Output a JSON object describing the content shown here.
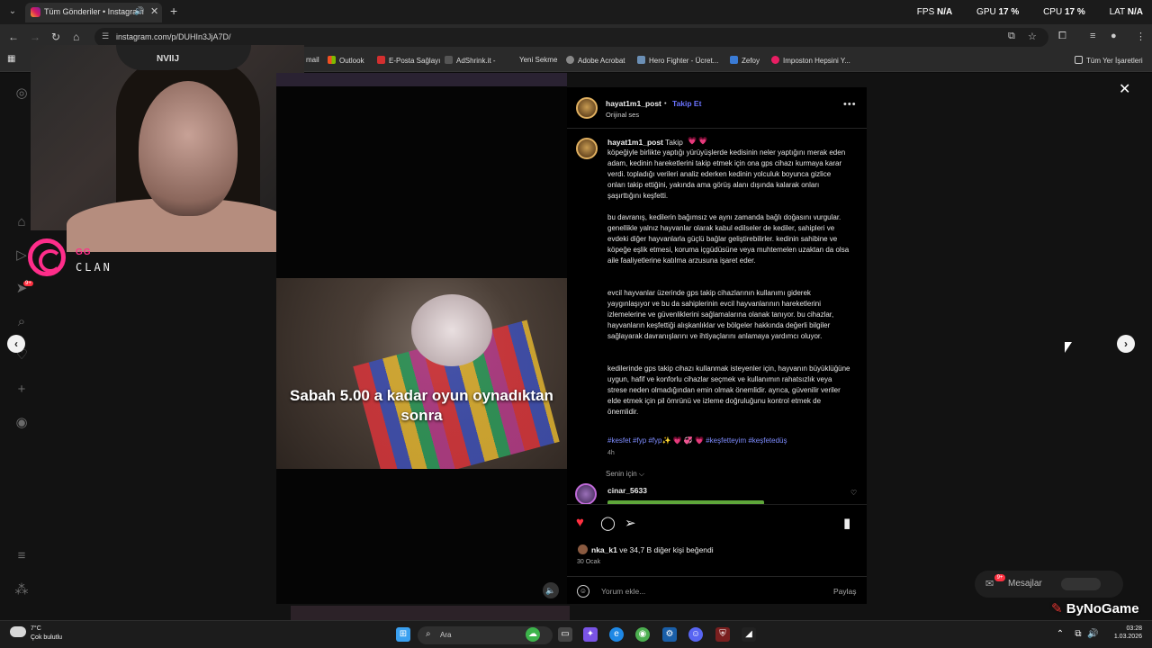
{
  "browser": {
    "tab_title": "Tüm Gönderiler • Instagram",
    "url": "instagram.com/p/DUHIn3JjA7D/",
    "stats": [
      {
        "label": "FPS",
        "value": "N/A"
      },
      {
        "label": "GPU",
        "value": "17 %"
      },
      {
        "label": "CPU",
        "value": "17 %"
      },
      {
        "label": "LAT",
        "value": "N/A"
      }
    ],
    "bookmarks": [
      "mail",
      "Outlook",
      "E-Posta Sağlayı",
      "AdShrink.it -",
      "Yeni Sekme",
      "Adobe Acrobat",
      "Hero Fighter - Ücret...",
      "Zefoy",
      "Imposton Hepsini Y..."
    ],
    "bookmarks_all": "Tüm Yer İşaretleri"
  },
  "overlay": {
    "cap_text": "NVIIJ",
    "logo_top": "GG",
    "logo_bottom": "CLAN"
  },
  "video": {
    "caption": "Sabah 5.00 a kadar oyun oynadıktan sonra"
  },
  "post": {
    "username": "hayat1m1_post",
    "follow": "Takip Et",
    "subtitle": "Orijinal ses",
    "caption_user": "hayat1m1_post",
    "caption_follow": "Takip",
    "paragraphs": [
      "köpeğiyle birlikte yaptığı yürüyüşlerde kedisinin neler yaptığını merak eden adam, kedinin hareketlerini takip etmek için ona gps cihazı kurmaya karar verdi. topladığı verileri analiz ederken kedinin yolculuk boyunca gizlice onları takip ettiğini, yakında ama görüş alanı dışında kalarak onları şaşırttığını keşfetti.",
      "bu davranış, kedilerin bağımsız ve aynı zamanda bağlı doğasını vurgular. genellikle yalnız hayvanlar olarak kabul edilseler de kediler, sahipleri ve evdeki diğer hayvanlarla güçlü bağlar geliştirebilirler. kedinin sahibine ve köpeğe eşlik etmesi, koruma içgüdüsüne veya muhtemelen uzaktan da olsa aile faaliyetlerine katılma arzusuna işaret eder.",
      "evcil hayvanlar üzerinde gps takip cihazlarının kullanımı giderek yaygınlaşıyor ve bu da sahiplerinin evcil hayvanlarının hareketlerini izlemelerine ve güvenliklerini sağlamalarına olanak tanıyor. bu cihazlar, hayvanların keşfettiği alışkanlıklar ve bölgeler hakkında değerli bilgiler sağlayarak davranışlarını ve ihtiyaçlarını anlamaya yardımcı oluyor.",
      "kedilerinde gps takip cihazı kullanmak isteyenler için, hayvanın büyüklüğüne uygun, hafif ve konforlu cihazlar seçmek ve kullanımın rahatsızlık veya strese neden olmadığından emin olmak önemlidir. ayrıca, güvenilir veriler elde etmek için pil ömrünü ve izleme doğruluğunu kontrol etmek de önemlidir."
    ],
    "hashtags": "#kesfet #fyp #fyp✨ 💗 💞 💗 #keşfetteyim #keşfetedüş",
    "time": "4h",
    "for_you": "Senin için ⌵",
    "comment_user": "cinar_5633",
    "likes_user": "nka_k1",
    "likes_rest": " ve 34,7 B diğer kişi beğendi",
    "date": "30 Ocak",
    "comment_placeholder": "Yorum ekle...",
    "share": "Paylaş"
  },
  "messages": {
    "label": "Mesajlar",
    "badge": "9+"
  },
  "sidebar_badge": "9+",
  "taskbar": {
    "temp": "7°C",
    "weather": "Çok bulutlu",
    "search": "Ara",
    "time": "03:28",
    "date": "1.03.2026"
  },
  "watermark": "ByNoGame"
}
